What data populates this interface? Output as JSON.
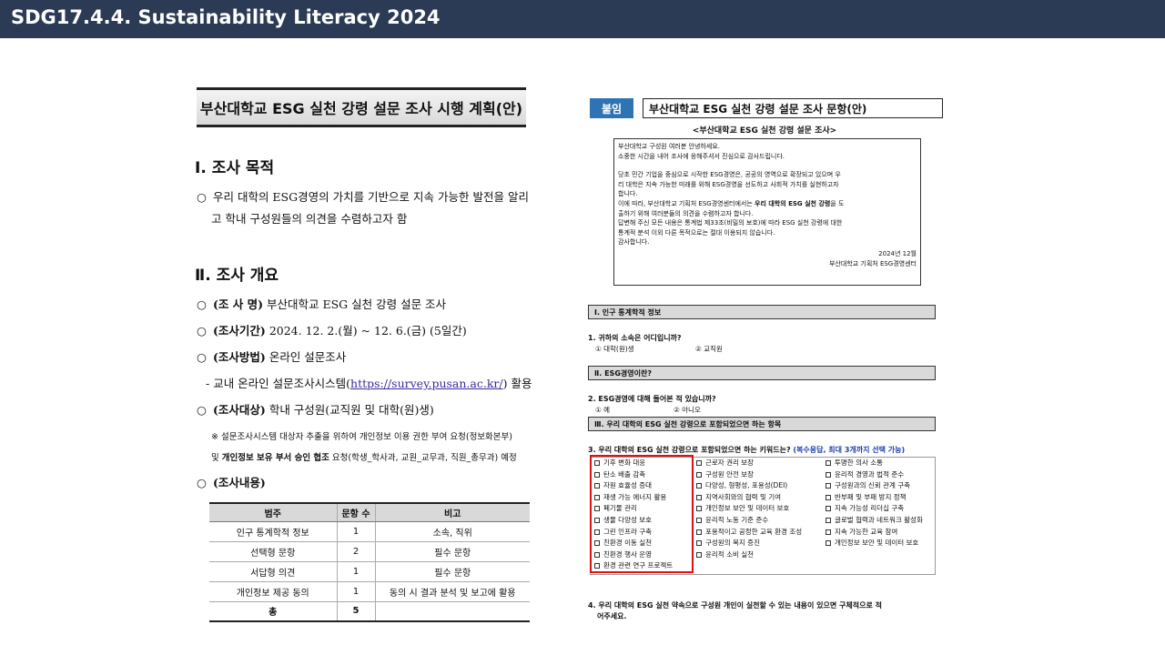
{
  "header": {
    "title": "SDG17.4.4. Sustainability Literacy 2024"
  },
  "left_doc": {
    "title": "부산대학교 ESG 실천 강령 설문 조사 시행 계획(안)",
    "section1": {
      "heading": "Ⅰ. 조사 목적",
      "bullet": "○",
      "line1": "우리 대학의 ESG경영의 가치를 기반으로 지속 가능한 발전을 알리",
      "line2": "고 학내 구성원들의 의견을 수렴하고자 함"
    },
    "section2": {
      "heading": "Ⅱ. 조사 개요",
      "name_label": "(조 사 명)",
      "name_value": "부산대학교 ESG 실천 강령 설문 조사",
      "period_label": "(조사기간)",
      "period_value": "2024. 12. 2.(월) ~ 12. 6.(금) (5일간)",
      "method_label": "(조사방법)",
      "method_value": "온라인 설문조사",
      "system_prefix": "- 교내 온라인 설문조사시스템(",
      "system_link": "https://survey.pusan.ac.kr/",
      "system_suffix": ") 활용",
      "target_label": "(조사대상)",
      "target_value": "학내 구성원(교직원 및 대학(원)생)",
      "note1": "※ 설문조사시스템 대상자 추출을 위하여 개인정보 이용 권한 부여 요청(정보화본부)",
      "note2_pre": "및 ",
      "note2_bold": "개인정보 보유 부서 승인 협조",
      "note2_post": " 요청(학생_학사과, 교원_교무과, 직원_총무과) 예정",
      "content_label": "(조사내용)"
    },
    "table": {
      "headers": [
        "범주",
        "문항 수",
        "비고"
      ],
      "rows": [
        [
          "인구 통계학적 정보",
          "1",
          "소속, 직위"
        ],
        [
          "선택형 문항",
          "2",
          "필수 문항"
        ],
        [
          "서답형 의견",
          "1",
          "필수 문항"
        ],
        [
          "개인정보 제공 동의",
          "1",
          "동의 시 결과 분석 및 보고에 활용"
        ]
      ],
      "total": [
        "총",
        "5",
        ""
      ]
    }
  },
  "right_doc": {
    "badge": "붙임",
    "title": "부산대학교 ESG 실천 강령 설문 조사 문항(안)",
    "subtitle": "<부산대학교 ESG 실천 강령 설문 조사>",
    "intro": {
      "l1": "부산대학교 구성원 여러분 안녕하세요.",
      "l2": "소중한 시간을 내어 조사에 응해주셔서 진심으로 감사드립니다.",
      "l3": "당초 민간 기업을 중심으로 시작한 ESG경영은, 공공의 영역으로 확장되고 있으며 우",
      "l4": "리 대학은 지속 가능한 미래를 위해 ESG경영을 선도하고 사회적 가치를 실현하고자",
      "l5": "합니다.",
      "l6a": "이에 따라, 부산대학교 기획처 ESG경영센터에서는 ",
      "l6b": "우리 대학의 ESG 실천 강령",
      "l6c": "을 도",
      "l7": "출하기 위해 여러분들의 의견을 수렴하고자 합니다.",
      "l8": "답변해 주신 모든 내용은 통계법 제33조(비밀의 보호)에 따라 ESG 실천 강령에 대한",
      "l9": "통계적 분석 이외 다른 목적으로는 절대 이용되지 않습니다.",
      "l10": "감사합니다.",
      "date": "2024년 12월",
      "org": "부산대학교 기획처 ESG경영센터"
    },
    "sec1": "Ⅰ. 인구 통계학적 정보",
    "q1": "1. 귀하의 소속은 어디입니까?",
    "q1_opt1": "① 대학(원)생",
    "q1_opt2": "② 교직원",
    "sec2": "Ⅱ. ESG경영이란?",
    "q2": "2. ESG경영에 대해 들어본 적 있습니까?",
    "q2_opt1": "① 예",
    "q2_opt2": "② 아니오",
    "sec3": "Ⅲ. 우리 대학의 ESG 실천 강령으로 포함되었으면 하는 항목",
    "q3": "3. 우리 대학의 ESG 실천 강령으로 포함되었으면 하는 키워드는? ",
    "q3_note": "(복수응답, 최대 3개까지 선택 가능)",
    "col1": [
      "기후 변화 대응",
      "탄소 배출 감축",
      "자원 효율성 증대",
      "재생 가능 에너지 활용",
      "폐기물 관리",
      "생물 다양성 보호",
      "그린 인프라 구축",
      "친환경 이동 실천",
      "친환경 행사 운영",
      "환경 관련 연구 프로젝트"
    ],
    "col2": [
      "근로자 권리 보장",
      "구성원 안전 보장",
      "다양성, 형평성, 포용성(DEI)",
      "지역사회와의 협력 및 기여",
      "개인정보 보안 및 데이터 보호",
      "윤리적 노동 기준 준수",
      "포용적이고 공정한 교육 환경 조성",
      "구성원의 복지 증진",
      "윤리적 소비 실천"
    ],
    "col3": [
      "투명한 의사 소통",
      "윤리적 경영과 법적 준수",
      "구성원과의 신뢰 관계 구축",
      "반부패 및 부패 방지 정책",
      "지속 가능성 리더십 구축",
      "글로벌 협력과 네트워크 활성화",
      "지속 가능한 교육 참여",
      "개인정보 보안 및 데이터 보호"
    ],
    "q4_l1": "4. 우리 대학의 ESG 실천 약속으로 구성원 개인이 실천할 수 있는 내용이 있으면 구체적으로 적",
    "q4_l2": "어주세요."
  }
}
